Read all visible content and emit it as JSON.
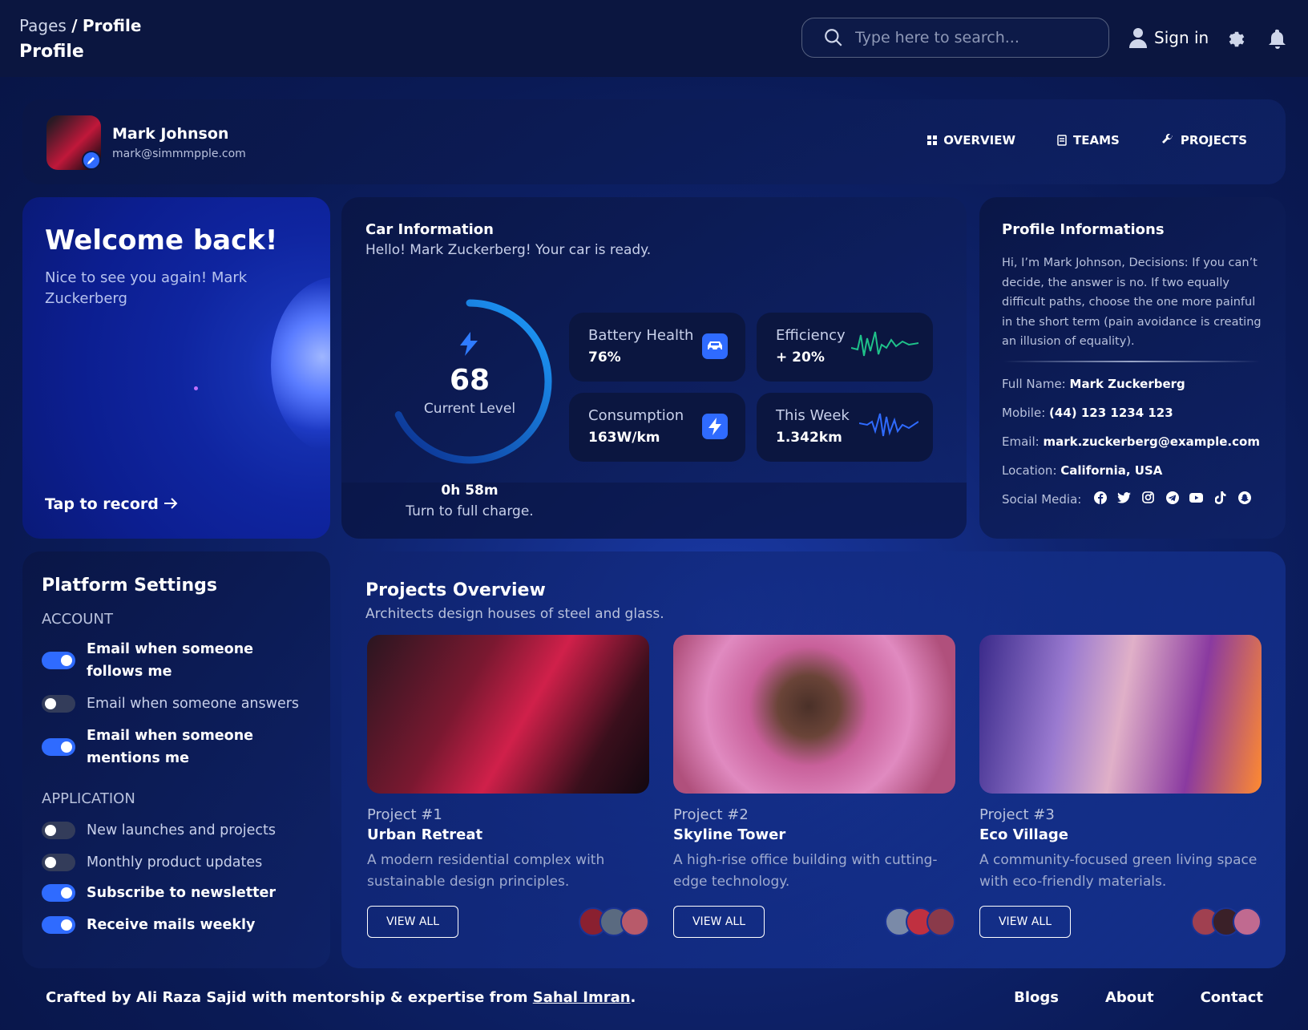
{
  "header": {
    "breadcrumb_parent": "Pages",
    "breadcrumb_separator": "/",
    "breadcrumb_current": "Profile",
    "page_title": "Profile",
    "search_placeholder": "Type here to search...",
    "sign_in": "Sign in"
  },
  "profile": {
    "name": "Mark Johnson",
    "email": "mark@simmmpple.com",
    "tabs": [
      "OVERVIEW",
      "TEAMS",
      "PROJECTS"
    ]
  },
  "welcome": {
    "title": "Welcome back!",
    "subtitle": "Nice to see you again! Mark Zuckerberg",
    "cta": "Tap to record"
  },
  "car": {
    "title": "Car Information",
    "subtitle": "Hello! Mark Zuckerberg! Your car is ready.",
    "level_value": "68",
    "level_fraction": 0.68,
    "level_label": "Current Level",
    "charge_time": "0h 58m",
    "charge_text": "Turn to full charge.",
    "stats": [
      {
        "label": "Battery Health",
        "value": "76%",
        "icon": "car-icon"
      },
      {
        "label": "Efficiency",
        "value": "+ 20%",
        "icon": "green-wave-icon"
      },
      {
        "label": "Consumption",
        "value": "163W/km",
        "icon": "bolt-icon"
      },
      {
        "label": "This Week",
        "value": "1.342km",
        "icon": "blue-wave-icon"
      }
    ]
  },
  "profile_info": {
    "title": "Profile Informations",
    "bio": "Hi, I’m Mark Johnson, Decisions: If you can’t decide, the answer is no. If two equally difficult paths, choose the one more painful in the short term (pain avoidance is creating an illusion of equality).",
    "full_name_label": "Full Name:",
    "full_name": "Mark Zuckerberg",
    "mobile_label": "Mobile:",
    "mobile": "(44) 123 1234 123",
    "email_label": "Email:",
    "email": "mark.zuckerberg@example.com",
    "location_label": "Location:",
    "location": "California, USA",
    "social_label": "Social Media:",
    "social_icons": [
      "facebook-icon",
      "twitter-icon",
      "instagram-icon",
      "telegram-icon",
      "youtube-icon",
      "tiktok-icon",
      "snapchat-icon"
    ]
  },
  "settings": {
    "title": "Platform Settings",
    "account_label": "ACCOUNT",
    "application_label": "APPLICATION",
    "account": [
      {
        "label": "Email when someone follows me",
        "on": true
      },
      {
        "label": "Email when someone answers",
        "on": false
      },
      {
        "label": "Email when someone mentions me",
        "on": true
      }
    ],
    "application": [
      {
        "label": "New launches and projects",
        "on": false
      },
      {
        "label": "Monthly product updates",
        "on": false
      },
      {
        "label": "Subscribe to newsletter",
        "on": true
      },
      {
        "label": "Receive mails weekly",
        "on": true
      }
    ]
  },
  "projects": {
    "title": "Projects Overview",
    "subtitle": "Architects design houses of steel and glass.",
    "button_label": "VIEW ALL",
    "items": [
      {
        "number": "Project #1",
        "title": "Urban Retreat",
        "description": "A modern residential complex with sustainable design principles."
      },
      {
        "number": "Project #2",
        "title": "Skyline Tower",
        "description": "A high-rise office building with cutting-edge technology."
      },
      {
        "number": "Project #3",
        "title": "Eco Village",
        "description": "A community-focused green living space with eco-friendly materials."
      }
    ]
  },
  "footer": {
    "credit_prefix": "Crafted by Ali Raza Sajid with mentorship & expertise from",
    "credit_link": "Sahal Imran",
    "credit_suffix": ".",
    "links": [
      "Blogs",
      "About",
      "Contact"
    ]
  },
  "colors": {
    "accent": "#2f6bff",
    "background": "#0a1a55",
    "topbar": "#0b1640",
    "gauge": "#1e8cff",
    "efficiency_wave": "#1fc28a",
    "week_wave": "#2f6bff"
  }
}
